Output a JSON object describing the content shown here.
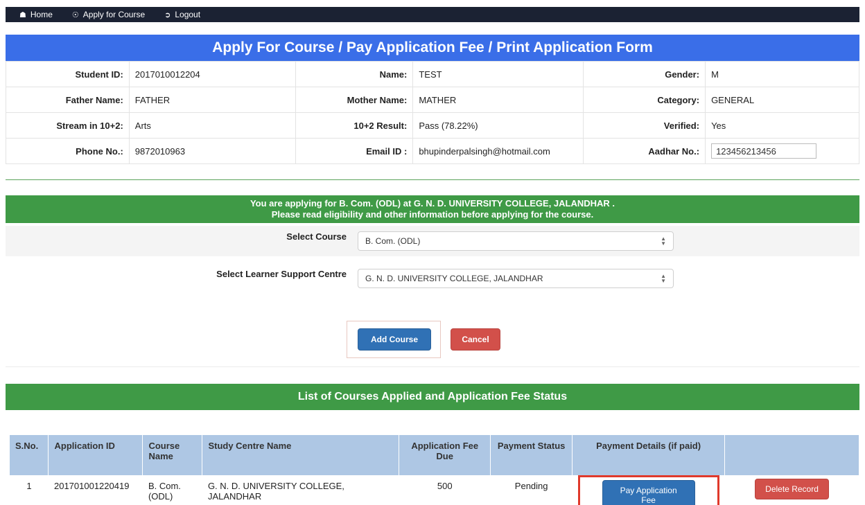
{
  "nav": {
    "home": "Home",
    "apply": "Apply for Course",
    "logout": "Logout"
  },
  "page_title": "Apply For Course / Pay Application Fee / Print Application Form",
  "student": {
    "id_label": "Student ID:",
    "id": "2017010012204",
    "name_label": "Name:",
    "name": "TEST",
    "gender_label": "Gender:",
    "gender": "M",
    "father_label": "Father Name:",
    "father": "FATHER",
    "mother_label": "Mother Name:",
    "mother": "MATHER",
    "category_label": "Category:",
    "category": "GENERAL",
    "stream_label": "Stream in 10+2:",
    "stream": "Arts",
    "result_label": "10+2 Result:",
    "result": "Pass (78.22%)",
    "verified_label": "Verified:",
    "verified": "Yes",
    "phone_label": "Phone No.:",
    "phone": "9872010963",
    "email_label": "Email ID :",
    "email": "bhupinderpalsingh@hotmail.com",
    "aadhar_label": "Aadhar No.:",
    "aadhar": "123456213456"
  },
  "notice": {
    "line1": "You are applying for B. Com. (ODL) at G. N. D. UNIVERSITY COLLEGE, JALANDHAR .",
    "line2": "Please read eligibility and other information before applying for the course."
  },
  "form": {
    "course_label": "Select Course",
    "course_value": "B. Com. (ODL)",
    "centre_label": "Select Learner Support Centre",
    "centre_value": "G. N. D. UNIVERSITY COLLEGE, JALANDHAR",
    "add_button": "Add Course",
    "cancel_button": "Cancel"
  },
  "list_title": "List of Courses Applied and Application Fee Status",
  "table": {
    "headers": [
      "S.No.",
      "Application ID",
      "Course Name",
      "Study Centre Name",
      "Application Fee Due",
      "Payment Status",
      "Payment Details (if paid)",
      ""
    ],
    "rows": [
      {
        "sno": "1",
        "app_id": "201701001220419",
        "course": "B. Com. (ODL)",
        "centre": "G. N. D. UNIVERSITY COLLEGE, JALANDHAR",
        "fee": "500",
        "status": "Pending",
        "pay_button": "Pay Application Fee",
        "delete_button": "Delete Record"
      }
    ]
  }
}
